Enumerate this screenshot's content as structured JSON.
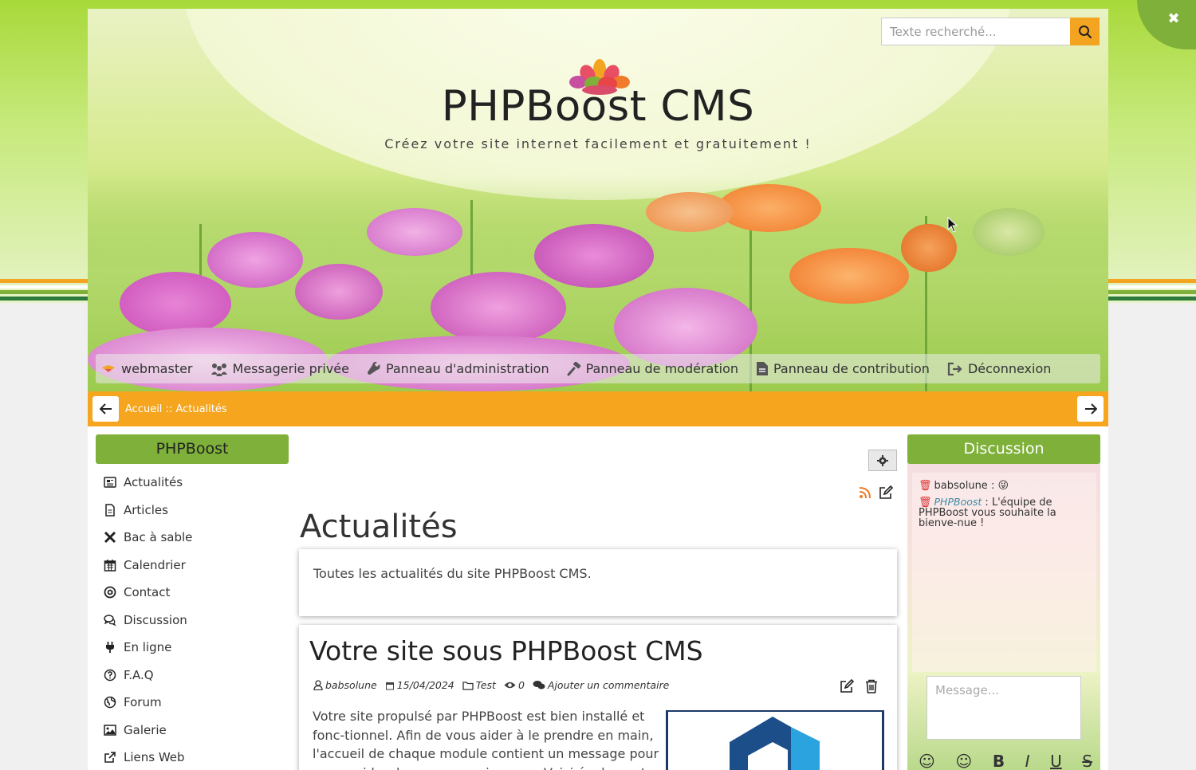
{
  "header": {
    "search_placeholder": "Texte recherché...",
    "site_title": "PHPBoost CMS",
    "slogan": "Créez votre site internet facilement et gratuitement !"
  },
  "user_menu": {
    "items": [
      {
        "label": "webmaster",
        "icon": "user-avatar-icon"
      },
      {
        "label": "Messagerie privée",
        "icon": "users-icon"
      },
      {
        "label": "Panneau d'administration",
        "icon": "wrench-icon"
      },
      {
        "label": "Panneau de modération",
        "icon": "gavel-icon"
      },
      {
        "label": "Panneau de contribution",
        "icon": "file-icon"
      },
      {
        "label": "Déconnexion",
        "icon": "sign-out-icon"
      }
    ]
  },
  "breadcrumb": {
    "text": "Accueil :: Actualités"
  },
  "left_menu": {
    "title": "PHPBoost",
    "items": [
      {
        "label": "Actualités",
        "icon": "newspaper-icon"
      },
      {
        "label": "Articles",
        "icon": "file-text-icon"
      },
      {
        "label": "Bac à sable",
        "icon": "tools-icon"
      },
      {
        "label": "Calendrier",
        "icon": "calendar-icon"
      },
      {
        "label": "Contact",
        "icon": "at-icon"
      },
      {
        "label": "Discussion",
        "icon": "comments-icon"
      },
      {
        "label": "En ligne",
        "icon": "plug-icon"
      },
      {
        "label": "F.A.Q",
        "icon": "question-icon"
      },
      {
        "label": "Forum",
        "icon": "globe-icon"
      },
      {
        "label": "Galerie",
        "icon": "image-icon"
      },
      {
        "label": "Liens Web",
        "icon": "external-link-icon"
      }
    ]
  },
  "content": {
    "page_title": "Actualités",
    "description": "Toutes les actualités du site PHPBoost CMS.",
    "article": {
      "title": "Votre site sous PHPBoost CMS",
      "author": "babsolune",
      "date": "15/04/2024",
      "category": "Test",
      "views": "0",
      "comments": "Ajouter un commentaire",
      "text": "Votre site propulsé par PHPBoost est bien installé et fonc-tionnel. Afin de vous aider à le prendre en main, l'accueil de chaque module contient un message pour vous guider dans vos premiers pas. Voici également quelques recom-"
    }
  },
  "discussion": {
    "title": "Discussion",
    "messages": [
      {
        "author": "babsolune",
        "sep": " : ",
        "text": "😜"
      },
      {
        "author": "PHPBoost",
        "sep": " : ",
        "text": "L'équipe de PHPBoost vous souhaite la bienve-nue !"
      }
    ],
    "input_placeholder": "Message..."
  },
  "colors": {
    "accent_orange": "#f5a51e",
    "accent_green": "#7eb03a"
  }
}
